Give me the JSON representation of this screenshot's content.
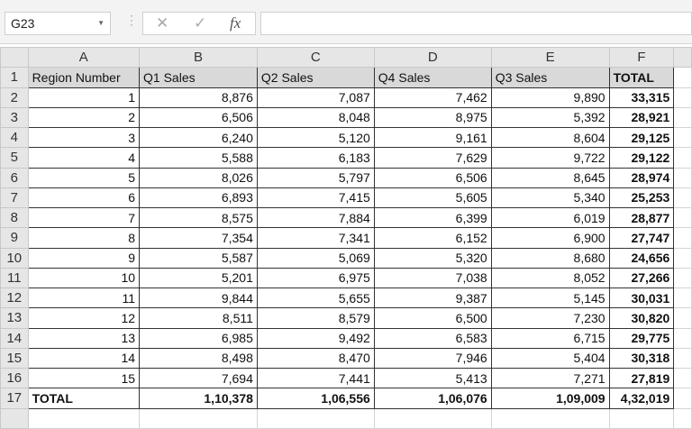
{
  "name_box": "G23",
  "formula_bar": {
    "cancel_icon": "x-icon",
    "enter_icon": "check-icon",
    "fx_label": "fx",
    "value": ""
  },
  "columns": [
    "A",
    "B",
    "C",
    "D",
    "E",
    "F"
  ],
  "headers": [
    "Region Number",
    "Q1 Sales",
    "Q2 Sales",
    "Q4 Sales",
    "Q3 Sales",
    "TOTAL"
  ],
  "rows": [
    [
      "1",
      "8,876",
      "7,087",
      "7,462",
      "9,890",
      "33,315"
    ],
    [
      "2",
      "6,506",
      "8,048",
      "8,975",
      "5,392",
      "28,921"
    ],
    [
      "3",
      "6,240",
      "5,120",
      "9,161",
      "8,604",
      "29,125"
    ],
    [
      "4",
      "5,588",
      "6,183",
      "7,629",
      "9,722",
      "29,122"
    ],
    [
      "5",
      "8,026",
      "5,797",
      "6,506",
      "8,645",
      "28,974"
    ],
    [
      "6",
      "6,893",
      "7,415",
      "5,605",
      "5,340",
      "25,253"
    ],
    [
      "7",
      "8,575",
      "7,884",
      "6,399",
      "6,019",
      "28,877"
    ],
    [
      "8",
      "7,354",
      "7,341",
      "6,152",
      "6,900",
      "27,747"
    ],
    [
      "9",
      "5,587",
      "5,069",
      "5,320",
      "8,680",
      "24,656"
    ],
    [
      "10",
      "5,201",
      "6,975",
      "7,038",
      "8,052",
      "27,266"
    ],
    [
      "11",
      "9,844",
      "5,655",
      "9,387",
      "5,145",
      "30,031"
    ],
    [
      "12",
      "8,511",
      "8,579",
      "6,500",
      "7,230",
      "30,820"
    ],
    [
      "13",
      "6,985",
      "9,492",
      "6,583",
      "6,715",
      "29,775"
    ],
    [
      "14",
      "8,498",
      "8,470",
      "7,946",
      "5,404",
      "30,318"
    ],
    [
      "15",
      "7,694",
      "7,441",
      "5,413",
      "7,271",
      "27,819"
    ]
  ],
  "total_row": [
    "TOTAL",
    "1,10,378",
    "1,06,556",
    "1,06,076",
    "1,09,009",
    "4,32,019"
  ],
  "row_numbers": [
    "1",
    "2",
    "3",
    "4",
    "5",
    "6",
    "7",
    "8",
    "9",
    "10",
    "11",
    "12",
    "13",
    "14",
    "15",
    "16",
    "17"
  ]
}
